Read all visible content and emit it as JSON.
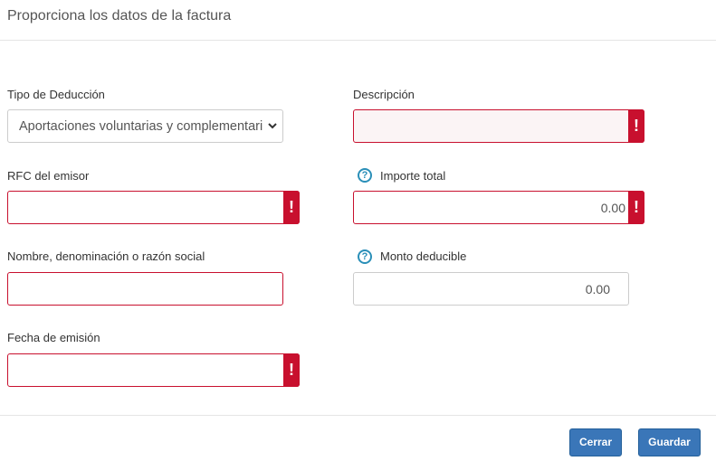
{
  "modal": {
    "title": "Proporciona los datos de la factura"
  },
  "form": {
    "tipo_deduccion": {
      "label": "Tipo de Deducción",
      "selected": "Aportaciones voluntarias y complementari"
    },
    "descripcion": {
      "label": "Descripción",
      "value": "",
      "error_icon": "!"
    },
    "rfc_emisor": {
      "label": "RFC del emisor",
      "value": "",
      "error_icon": "!"
    },
    "importe_total": {
      "label": "Importe total",
      "value": "0.00",
      "help_icon": "?",
      "error_icon": "!"
    },
    "nombre": {
      "label": "Nombre, denominación o razón social",
      "value": ""
    },
    "monto_deducible": {
      "label": "Monto deducible",
      "value": "0.00",
      "help_icon": "?"
    },
    "fecha_emision": {
      "label": "Fecha de emisión",
      "value": "",
      "error_icon": "!"
    }
  },
  "footer": {
    "cerrar_label": "Cerrar",
    "guardar_label": "Guardar"
  },
  "colors": {
    "error": "#c8102e",
    "primary_button": "#3a76b8",
    "help_icon": "#2a8fb8"
  },
  "icons": {
    "select_arrow": "chevron-down-icon",
    "error": "exclamation-icon",
    "help": "question-circle-icon"
  }
}
